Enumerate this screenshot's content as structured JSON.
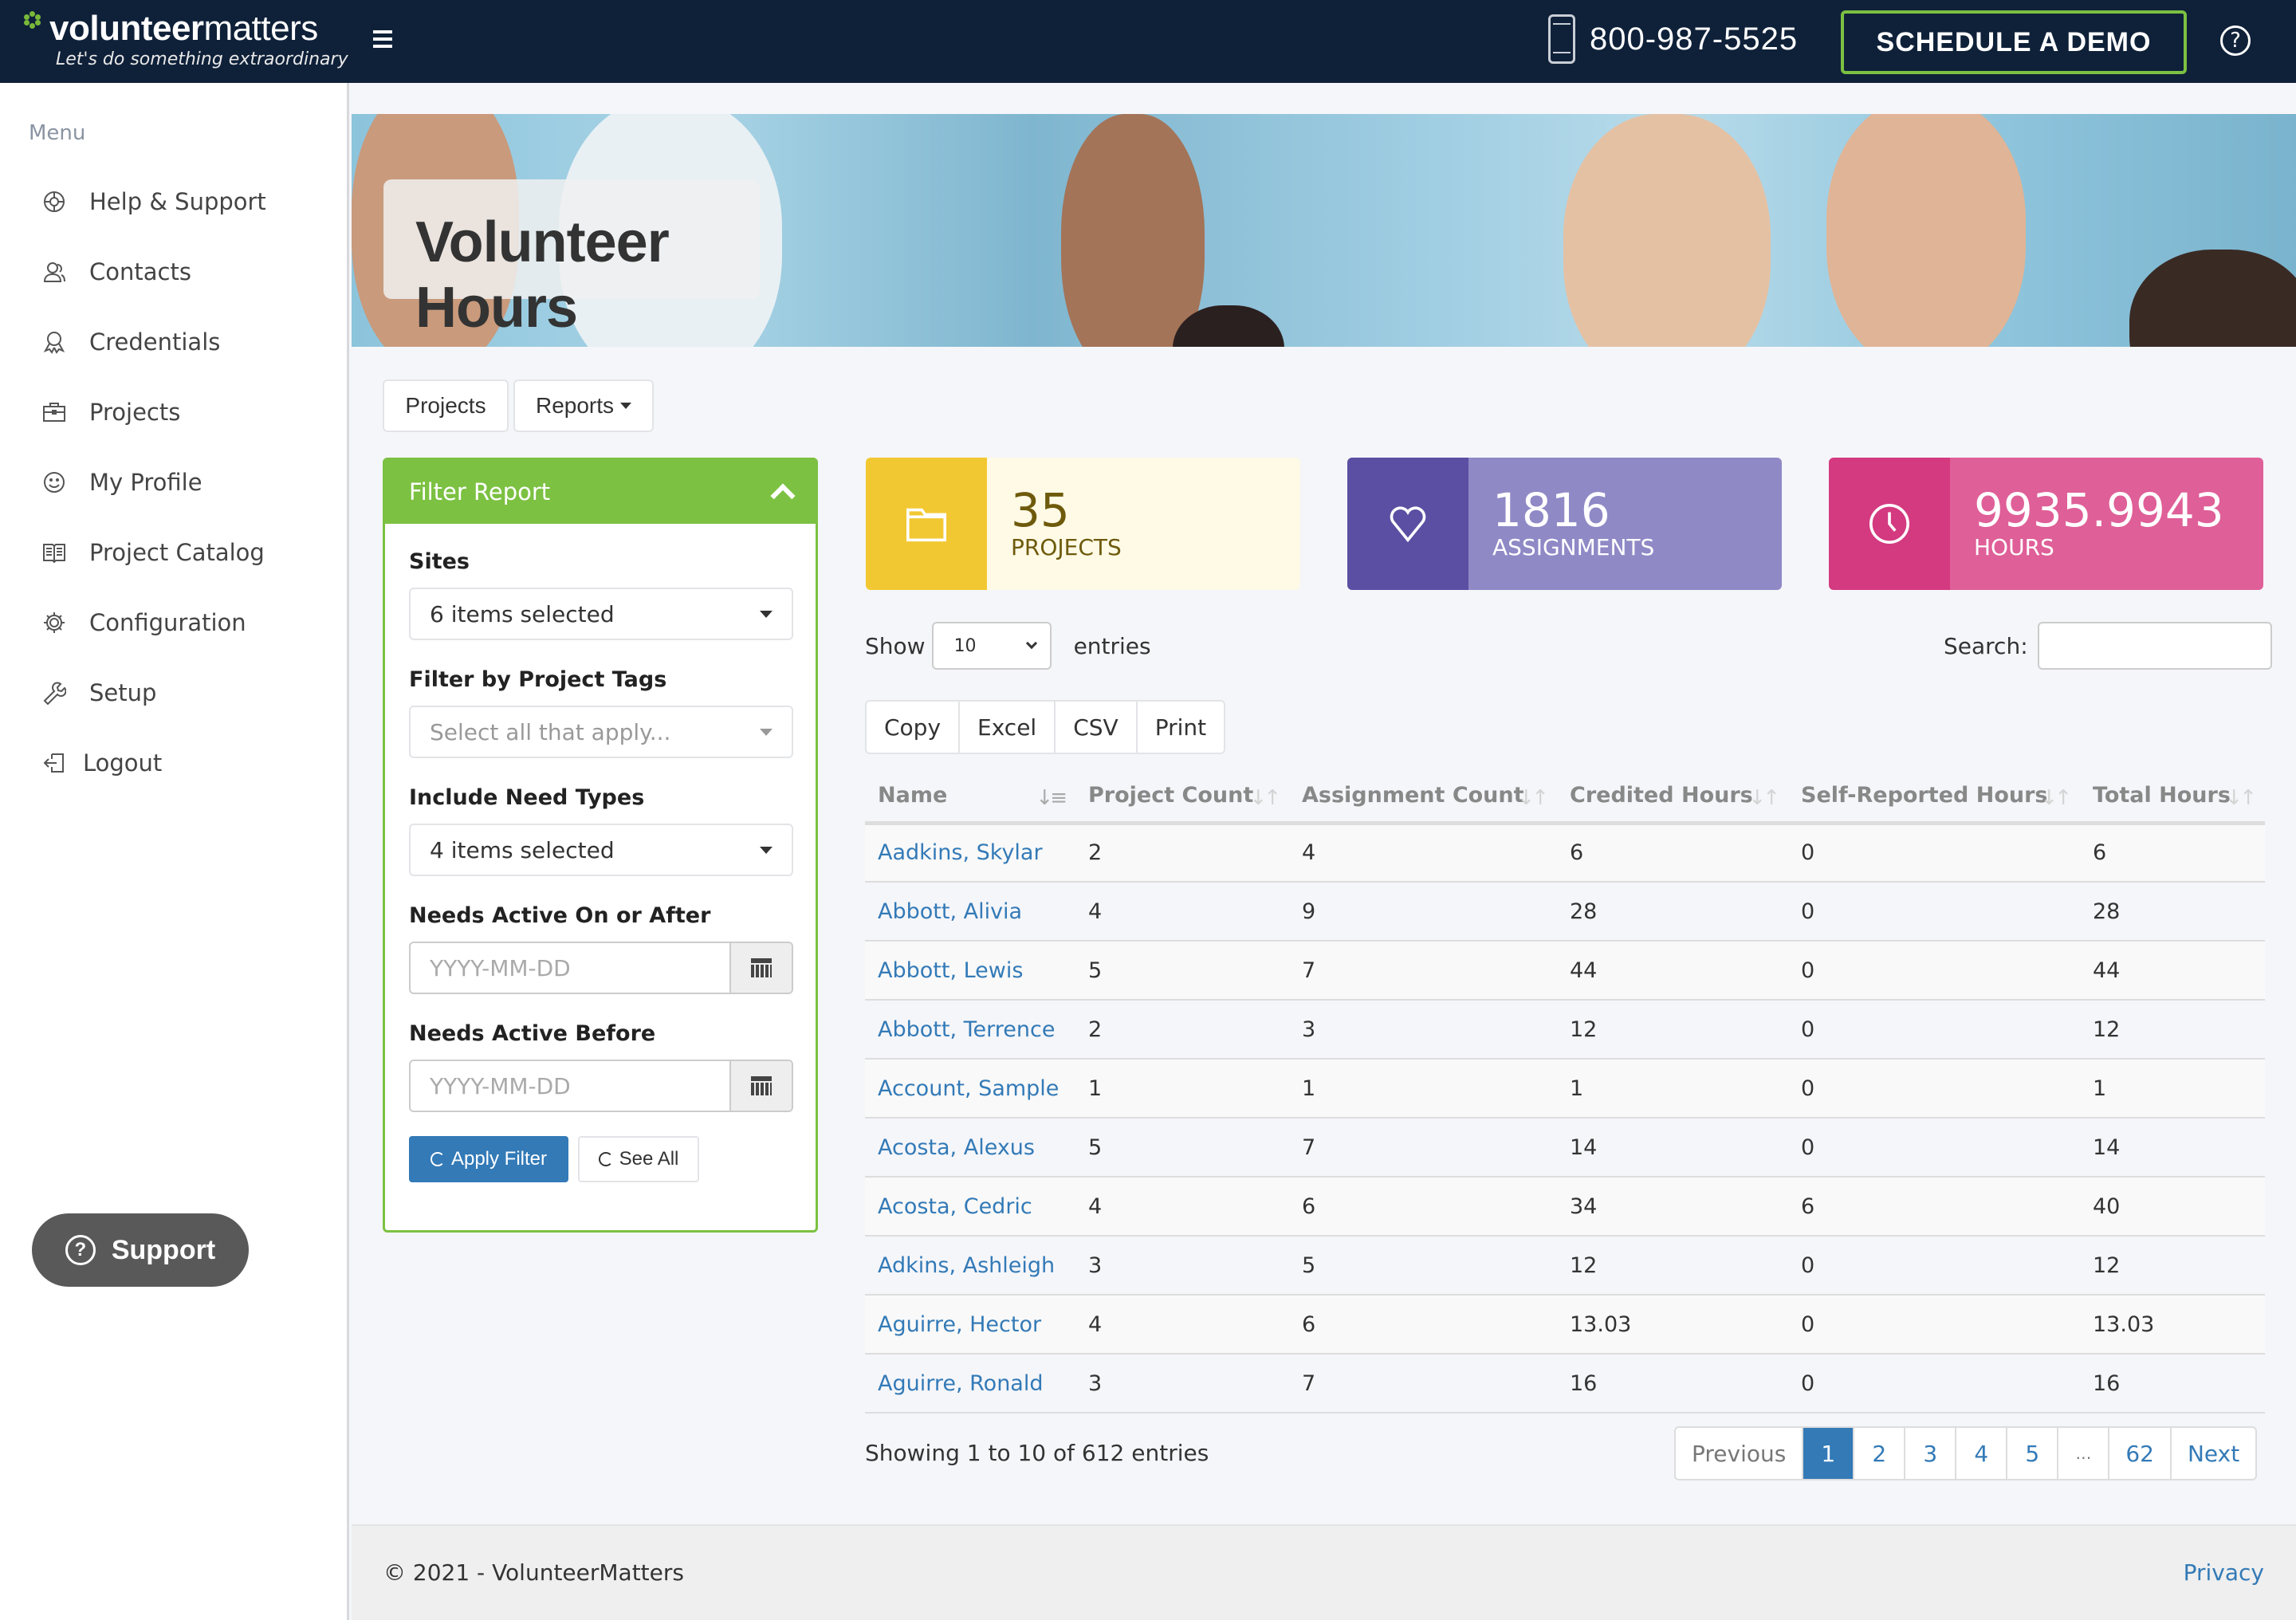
{
  "header": {
    "logo_bold": "volunteer",
    "logo_light": "matters",
    "tagline": "Let's do something extraordinary",
    "phone": "800-987-5525",
    "demo_button": "SCHEDULE A DEMO"
  },
  "sidebar": {
    "menu_label": "Menu",
    "items": [
      {
        "label": "Help & Support",
        "icon": "lifebuoy-icon"
      },
      {
        "label": "Contacts",
        "icon": "users-icon"
      },
      {
        "label": "Credentials",
        "icon": "badge-icon"
      },
      {
        "label": "Projects",
        "icon": "briefcase-icon"
      },
      {
        "label": "My Profile",
        "icon": "smiley-icon"
      },
      {
        "label": "Project Catalog",
        "icon": "book-icon"
      },
      {
        "label": "Configuration",
        "icon": "gear-icon"
      },
      {
        "label": "Setup",
        "icon": "wrench-icon"
      },
      {
        "label": "Logout",
        "icon": "logout-icon"
      }
    ],
    "support_button": "Support"
  },
  "hero": {
    "title": "Volunteer Hours"
  },
  "tabs": {
    "projects": "Projects",
    "reports": "Reports"
  },
  "filter": {
    "title": "Filter Report",
    "sites_label": "Sites",
    "sites_value": "6 items selected",
    "tags_label": "Filter by Project Tags",
    "tags_placeholder": "Select all that apply...",
    "need_types_label": "Include Need Types",
    "need_types_value": "4 items selected",
    "active_after_label": "Needs Active On or After",
    "active_after_placeholder": "YYYY-MM-DD",
    "active_before_label": "Needs Active Before",
    "active_before_placeholder": "YYYY-MM-DD",
    "apply_button": "Apply Filter",
    "see_all_button": "See All"
  },
  "stats": {
    "projects": {
      "value": "35",
      "label": "PROJECTS",
      "colors": {
        "icon_bg": "#f2c832",
        "body_bg": "#fefae6",
        "text": "#6e5a0c"
      }
    },
    "assignments": {
      "value": "1816",
      "label": "ASSIGNMENTS",
      "colors": {
        "icon_bg": "#5a4fa2",
        "body_bg": "#8f89c6",
        "text": "#ffffff"
      }
    },
    "hours": {
      "value": "9935.9943",
      "label": "HOURS",
      "colors": {
        "icon_bg": "#d43a80",
        "body_bg": "#df5f98",
        "text": "#ffffff"
      }
    }
  },
  "table_controls": {
    "show_label": "Show",
    "page_length": "10",
    "entries_label": "entries",
    "search_label": "Search:",
    "search_value": "",
    "export_buttons": [
      "Copy",
      "Excel",
      "CSV",
      "Print"
    ]
  },
  "table": {
    "columns": [
      "Name",
      "Project Count",
      "Assignment Count",
      "Credited Hours",
      "Self-Reported Hours",
      "Total Hours"
    ],
    "rows": [
      [
        "Aadkins, Skylar",
        "2",
        "4",
        "6",
        "0",
        "6"
      ],
      [
        "Abbott, Alivia",
        "4",
        "9",
        "28",
        "0",
        "28"
      ],
      [
        "Abbott, Lewis",
        "5",
        "7",
        "44",
        "0",
        "44"
      ],
      [
        "Abbott, Terrence",
        "2",
        "3",
        "12",
        "0",
        "12"
      ],
      [
        "Account, Sample",
        "1",
        "1",
        "1",
        "0",
        "1"
      ],
      [
        "Acosta, Alexus",
        "5",
        "7",
        "14",
        "0",
        "14"
      ],
      [
        "Acosta, Cedric",
        "4",
        "6",
        "34",
        "6",
        "40"
      ],
      [
        "Adkins, Ashleigh",
        "3",
        "5",
        "12",
        "0",
        "12"
      ],
      [
        "Aguirre, Hector",
        "4",
        "6",
        "13.03",
        "0",
        "13.03"
      ],
      [
        "Aguirre, Ronald",
        "3",
        "7",
        "16",
        "0",
        "16"
      ]
    ]
  },
  "pagination": {
    "info": "Showing 1 to 10 of 612 entries",
    "previous": "Previous",
    "pages": [
      "1",
      "2",
      "3",
      "4",
      "5",
      "…",
      "62"
    ],
    "current": "1",
    "next": "Next"
  },
  "footer": {
    "copyright": "© 2021 - VolunteerMatters",
    "privacy": "Privacy"
  }
}
